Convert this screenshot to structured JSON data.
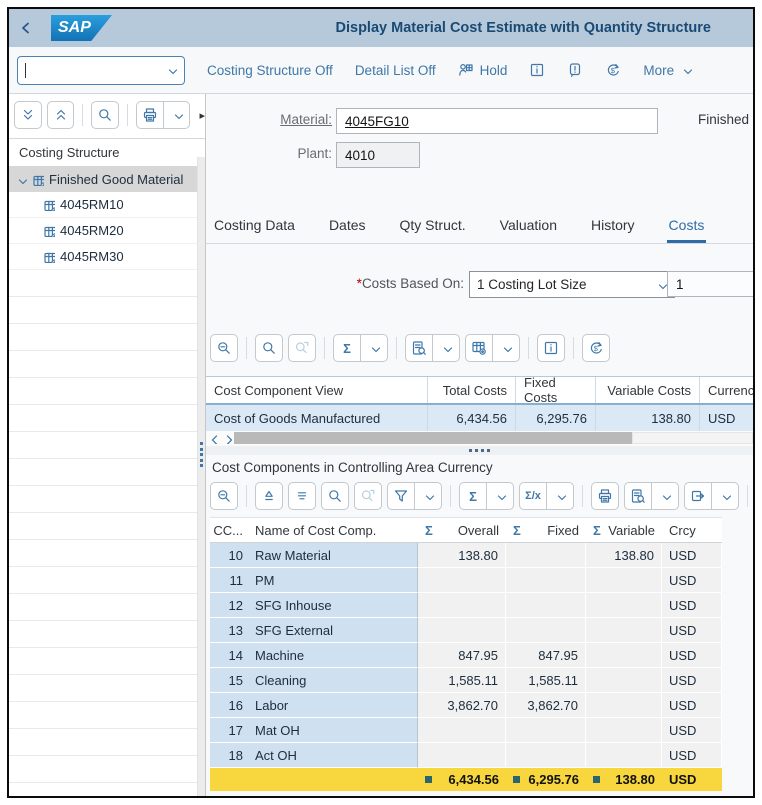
{
  "shell": {
    "logo": "SAP",
    "title": "Display Material Cost Estimate with Quantity Structure"
  },
  "toolbar": {
    "costing_structure_label": "Costing Structure Off",
    "detail_list_label": "Detail List Off",
    "hold_label": "Hold",
    "more_label": "More"
  },
  "sidebar": {
    "header": "Costing Structure",
    "root_item": "Finished Good Material",
    "items": [
      {
        "label": "4045RM10"
      },
      {
        "label": "4045RM20"
      },
      {
        "label": "4045RM30"
      }
    ]
  },
  "form": {
    "material_label": "Material:",
    "material_value": "4045FG10",
    "material_description": "Finished",
    "plant_label": "Plant:",
    "plant_value": "4010"
  },
  "tabs": {
    "items": [
      "Costing Data",
      "Dates",
      "Qty Struct.",
      "Valuation",
      "History",
      "Costs"
    ],
    "active": "Costs"
  },
  "costs_based_on": {
    "required_marker": "*",
    "label": "Costs Based On:",
    "selected_option": "1 Costing Lot Size",
    "lot_size_value": "1"
  },
  "icons": {
    "sum": "Σ",
    "subtotal": "Σ/x"
  },
  "cost_view_table": {
    "headers": [
      "Cost Component View",
      "Total Costs",
      "Fixed Costs",
      "Variable Costs",
      "Currency"
    ],
    "row": {
      "view": "Cost of Goods Manufactured",
      "total": "6,434.56",
      "fixed": "6,295.76",
      "variable": "138.80",
      "currency": "USD"
    }
  },
  "cost_components": {
    "title": "Cost Components in Controlling Area Currency",
    "headers": {
      "cc": "CC...",
      "name": "Name of Cost Comp.",
      "overall": "Overall",
      "fixed": "Fixed",
      "variable": "Variable",
      "crcy": "Crcy"
    },
    "rows": [
      {
        "cc": "10",
        "name": "Raw Material",
        "overall": "138.80",
        "fixed": "",
        "variable": "138.80",
        "crcy": "USD"
      },
      {
        "cc": "11",
        "name": "PM",
        "overall": "",
        "fixed": "",
        "variable": "",
        "crcy": "USD"
      },
      {
        "cc": "12",
        "name": "SFG Inhouse",
        "overall": "",
        "fixed": "",
        "variable": "",
        "crcy": "USD"
      },
      {
        "cc": "13",
        "name": "SFG External",
        "overall": "",
        "fixed": "",
        "variable": "",
        "crcy": "USD"
      },
      {
        "cc": "14",
        "name": "Machine",
        "overall": "847.95",
        "fixed": "847.95",
        "variable": "",
        "crcy": "USD"
      },
      {
        "cc": "15",
        "name": "Cleaning",
        "overall": "1,585.11",
        "fixed": "1,585.11",
        "variable": "",
        "crcy": "USD"
      },
      {
        "cc": "16",
        "name": "Labor",
        "overall": "3,862.70",
        "fixed": "3,862.70",
        "variable": "",
        "crcy": "USD"
      },
      {
        "cc": "17",
        "name": "Mat OH",
        "overall": "",
        "fixed": "",
        "variable": "",
        "crcy": "USD"
      },
      {
        "cc": "18",
        "name": "Act OH",
        "overall": "",
        "fixed": "",
        "variable": "",
        "crcy": "USD"
      }
    ],
    "total": {
      "overall": "6,434.56",
      "fixed": "6,295.76",
      "variable": "138.80",
      "crcy": "USD"
    }
  },
  "colors": {
    "accent_blue": "#3f77a9",
    "shell_bg": "#b5c9da",
    "selected_row": "#dbe9f7",
    "total_row_yellow": "#f7d73d",
    "total_marker_teal": "#2c6470",
    "tree_selected": "#d7d7d7"
  }
}
